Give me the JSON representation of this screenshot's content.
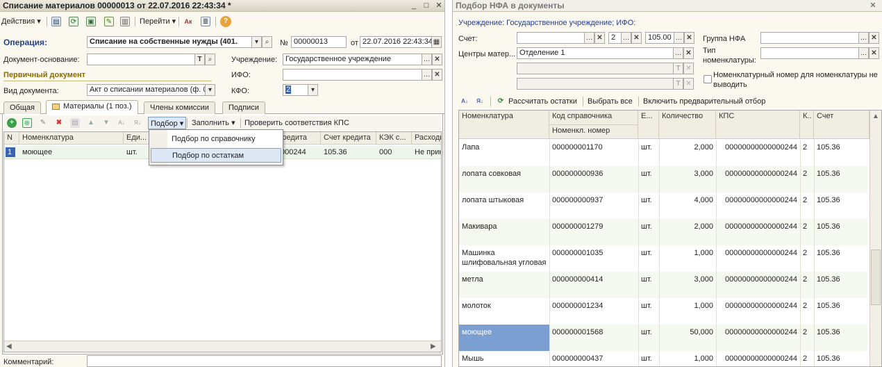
{
  "left_window": {
    "title": "Списание материалов 00000013 от 22.07.2016 22:43:34 *",
    "title_buttons": [
      "_",
      "□",
      "✕"
    ],
    "toolbar": {
      "actions_label": "Действия",
      "goto_label": "Перейти",
      "help_icon": "?"
    },
    "form": {
      "operation_label": "Операция:",
      "operation_value": "Списание на собственные нужды (401.",
      "number_label": "№",
      "number_value": "00000013",
      "date_prefix": "от",
      "date_value": "22.07.2016 22:43:34",
      "base_doc_label": "Документ-основание:",
      "institution_label": "Учреждение:",
      "institution_value": "Государственное учреждение",
      "primary_doc_label": "Первичный документ",
      "ifo_label": "ИФО:",
      "doc_type_label": "Вид документа:",
      "doc_type_value": "Акт о списании материалов (ф. 0",
      "kfo_label": "КФО:",
      "kfo_value": "2"
    },
    "tabs": [
      "Общая",
      "Материалы (1 поз.)",
      "Члены комиссии",
      "Подписи"
    ],
    "subtoolbar": {
      "podbor_label": "Подбор",
      "fill_label": "Заполнить",
      "check_label": "Проверить соответствия КПС"
    },
    "menu_items": [
      "Подбор по справочнику",
      "Подбор по остаткам"
    ],
    "grid_headers": [
      "N",
      "Номенклатура",
      "Еди...",
      "Кредита",
      "Счет кредита",
      "КЭК с...",
      "Расходы"
    ],
    "grid_row": [
      "1",
      "моющее",
      "шт.",
      "000244",
      "105.36",
      "000",
      "Не прин"
    ],
    "comment_label": "Комментарий:"
  },
  "right_window": {
    "title": "Подбор НФА в документы",
    "info_line": "Учреждение: Государственное учреждение; ИФО:",
    "account_label": "Счет:",
    "account_kfo": "2",
    "account_value": "105.00",
    "centers_label": "Центры матер...",
    "centers_value": "Отделение 1",
    "nfa_group_label": "Группа НФА",
    "nom_type_label": "Тип номенклатуры:",
    "checkbox_label": "Номенклатурный номер для номенклатуры не выводить",
    "toolbar": {
      "recalc_label": "Рассчитать остатки",
      "select_all_label": "Выбрать все",
      "prefilter_label": "Включить предварительный отбор"
    },
    "headers": {
      "nom": "Номенклатура",
      "code": "Код справочника",
      "code_sub": "Номенкл. номер",
      "unit": "Е...",
      "qty": "Количество",
      "kps": "КПС",
      "k": "К..",
      "account": "Счет"
    },
    "rows": [
      {
        "nom": "Лапа",
        "code": "000000001170",
        "unit": "шт.",
        "qty": "2,000",
        "kps": "00000000000000244",
        "k": "2",
        "account": "105.36",
        "selected": false
      },
      {
        "nom": "лопата совковая",
        "code": "000000000936",
        "unit": "шт.",
        "qty": "3,000",
        "kps": "00000000000000244",
        "k": "2",
        "account": "105.36",
        "selected": false
      },
      {
        "nom": "лопата штыковая",
        "code": "000000000937",
        "unit": "шт.",
        "qty": "4,000",
        "kps": "00000000000000244",
        "k": "2",
        "account": "105.36",
        "selected": false
      },
      {
        "nom": "Макивара",
        "code": "000000001279",
        "unit": "шт.",
        "qty": "2,000",
        "kps": "00000000000000244",
        "k": "2",
        "account": "105.36",
        "selected": false
      },
      {
        "nom": "Машинка шлифовальная угловая",
        "code": "000000001035",
        "unit": "шт.",
        "qty": "1,000",
        "kps": "00000000000000244",
        "k": "2",
        "account": "105.36",
        "selected": false
      },
      {
        "nom": "метла",
        "code": "000000000414",
        "unit": "шт.",
        "qty": "3,000",
        "kps": "00000000000000244",
        "k": "2",
        "account": "105.36",
        "selected": false
      },
      {
        "nom": "молоток",
        "code": "000000001234",
        "unit": "шт.",
        "qty": "1,000",
        "kps": "00000000000000244",
        "k": "2",
        "account": "105.36",
        "selected": false
      },
      {
        "nom": "моющее",
        "code": "000000001568",
        "unit": "шт.",
        "qty": "50,000",
        "kps": "00000000000000244",
        "k": "2",
        "account": "105.36",
        "selected": true
      },
      {
        "nom": "Мышь",
        "code": "000000000437",
        "unit": "шт.",
        "qty": "1,000",
        "kps": "00000000000000244",
        "k": "2",
        "account": "105.36",
        "selected": false
      }
    ]
  },
  "colors": {
    "selected_row": "#7b9fd0",
    "accent_title": "#1f3f8f",
    "primary_doc": "#8a6b00"
  }
}
